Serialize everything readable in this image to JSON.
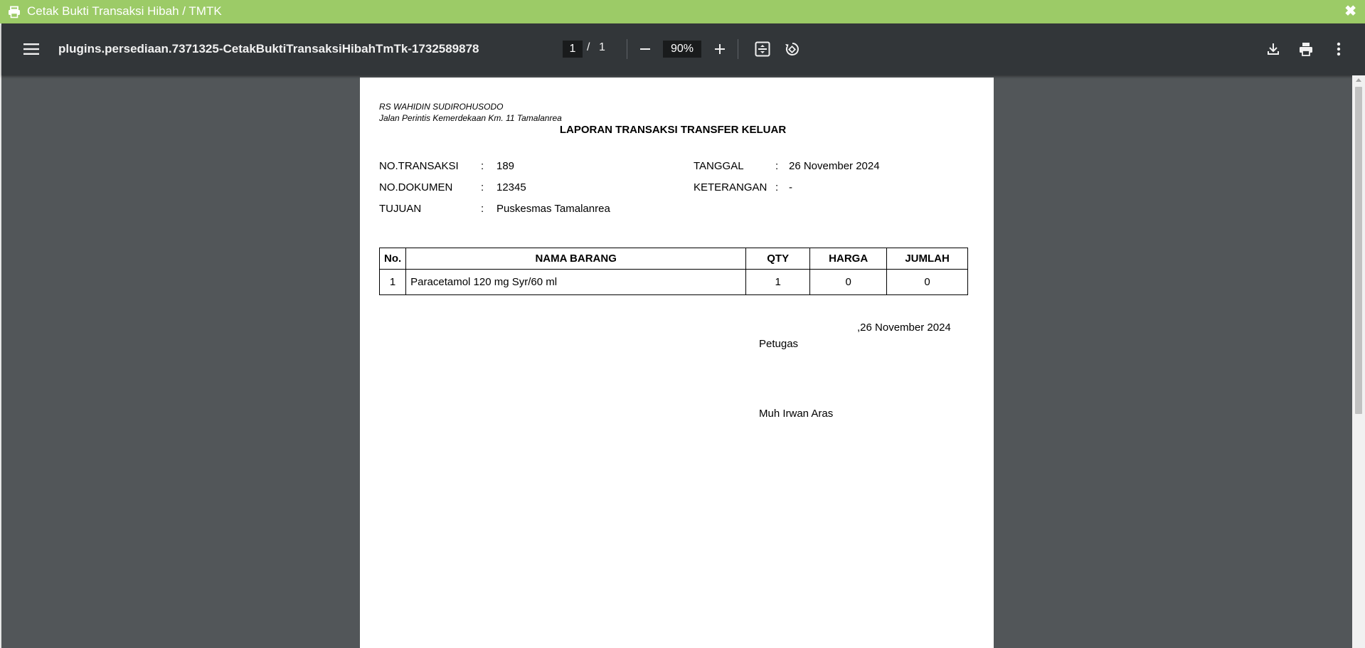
{
  "window": {
    "title": "Cetak Bukti Transaksi Hibah / TMTK",
    "title_icon": "printer-icon",
    "close_label": "✖"
  },
  "toolbar": {
    "filename": "plugins.persediaan.7371325-CetakBuktiTransaksiHibahTmTk-1732589878",
    "current_page": "1",
    "page_separator": "/",
    "total_pages": "1",
    "zoom": "90%",
    "icons": [
      "menu-icon",
      "zoom-out-icon",
      "zoom-in-icon",
      "fit-page-icon",
      "rotate-icon",
      "download-icon",
      "print-icon",
      "more-icon"
    ]
  },
  "document": {
    "hospital_name": "RS WAHIDIN SUDIROHUSODO",
    "hospital_address": "Jalan Perintis Kemerdekaan Km. 11 Tamalanrea",
    "report_title": "LAPORAN TRANSAKSI TRANSFER KELUAR",
    "fields": {
      "no_transaksi": {
        "label": "NO.TRANSAKSI",
        "colon": ":",
        "value": "189"
      },
      "no_dokumen": {
        "label": "NO.DOKUMEN",
        "colon": ":",
        "value": "12345"
      },
      "tujuan": {
        "label": "TUJUAN",
        "colon": ":",
        "value": "Puskesmas Tamalanrea"
      },
      "tanggal": {
        "label": "TANGGAL",
        "colon": ":",
        "value": "26 November 2024"
      },
      "keterangan": {
        "label": "KETERANGAN",
        "colon": ":",
        "value": "-"
      }
    },
    "table": {
      "headers": [
        "No.",
        "NAMA BARANG",
        "QTY",
        "HARGA",
        "JUMLAH"
      ],
      "rows": [
        [
          "1",
          "Paracetamol 120 mg Syr/60 ml",
          "1",
          "0",
          "0"
        ]
      ]
    },
    "signature": {
      "date": ",26 November 2024",
      "role": "Petugas",
      "name": "Muh Irwan Aras"
    }
  },
  "colors": {
    "titlebar": "#9ccb67",
    "toolbar": "#323639",
    "viewer_background": "#525659"
  }
}
